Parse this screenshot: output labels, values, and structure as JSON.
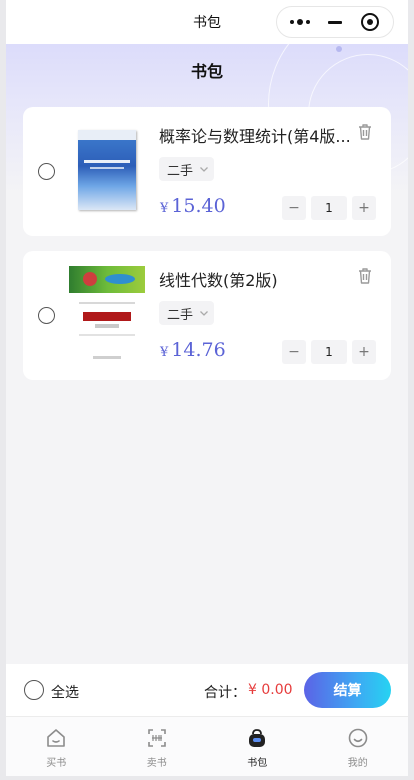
{
  "nav": {
    "title": "书包",
    "capsule": {
      "more_icon": "more-dots-icon",
      "minimize_icon": "minimize-icon",
      "close_icon": "target-circle-icon"
    }
  },
  "page": {
    "title": "书包"
  },
  "cart": {
    "items": [
      {
        "title": "概率论与数理统计(第4版...",
        "condition": "二手",
        "currency": "¥",
        "price": "15.40",
        "quantity": "1",
        "minus": "−",
        "plus": "+",
        "selected": false
      },
      {
        "title": "线性代数(第2版)",
        "condition": "二手",
        "currency": "¥",
        "price": "14.76",
        "quantity": "1",
        "minus": "−",
        "plus": "+",
        "selected": false
      }
    ]
  },
  "checkout": {
    "select_all_label": "全选",
    "total_label": "合计：",
    "total_value": "¥ 0.00",
    "pay_label": "结算"
  },
  "tabbar": {
    "tabs": [
      {
        "label": "买书",
        "icon": "home-icon",
        "active": false
      },
      {
        "label": "卖书",
        "icon": "scan-icon",
        "active": false
      },
      {
        "label": "书包",
        "icon": "bag-icon",
        "active": true
      },
      {
        "label": "我的",
        "icon": "smile-icon",
        "active": false
      }
    ]
  },
  "colors": {
    "accent": "#5b63d6",
    "price_red": "#e63c3c",
    "pay_gradient_start": "#5b63e6",
    "pay_gradient_end": "#26d3f2"
  }
}
